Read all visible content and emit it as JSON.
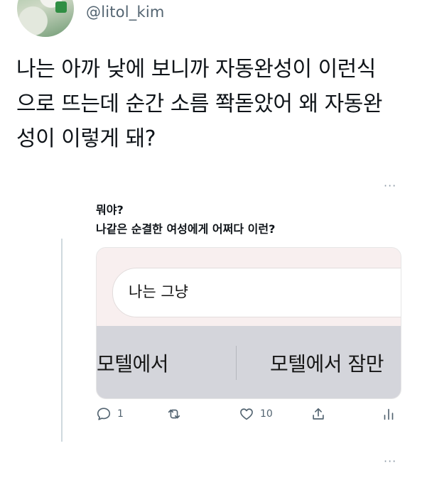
{
  "tweet": {
    "handle": "@litol_kim",
    "text_lines": [
      "나는 아까 낮에 보니까 자동완성이 이런식",
      "으로 뜨는데 순간 소름 쫙돋았어 왜 자동완",
      "성이 이렇게 돼?"
    ]
  },
  "more_label": "···",
  "reply": {
    "name": "뭐야?",
    "text": "나같은 순결한 여성에게 어쩌다 이런?",
    "card": {
      "search_value": "나는 그냥",
      "suggestions": [
        "모텔에서",
        "모텔에서 잠만"
      ]
    },
    "actions": {
      "reply_count": "1",
      "retweet_count": "",
      "like_count": "10"
    }
  },
  "icons": [
    "reply-icon",
    "retweet-icon",
    "like-icon",
    "share-icon",
    "analytics-icon",
    "more-icon"
  ],
  "colors": {
    "text": "#0f1419",
    "secondary": "#536471",
    "thread_line": "#cfd9de"
  }
}
